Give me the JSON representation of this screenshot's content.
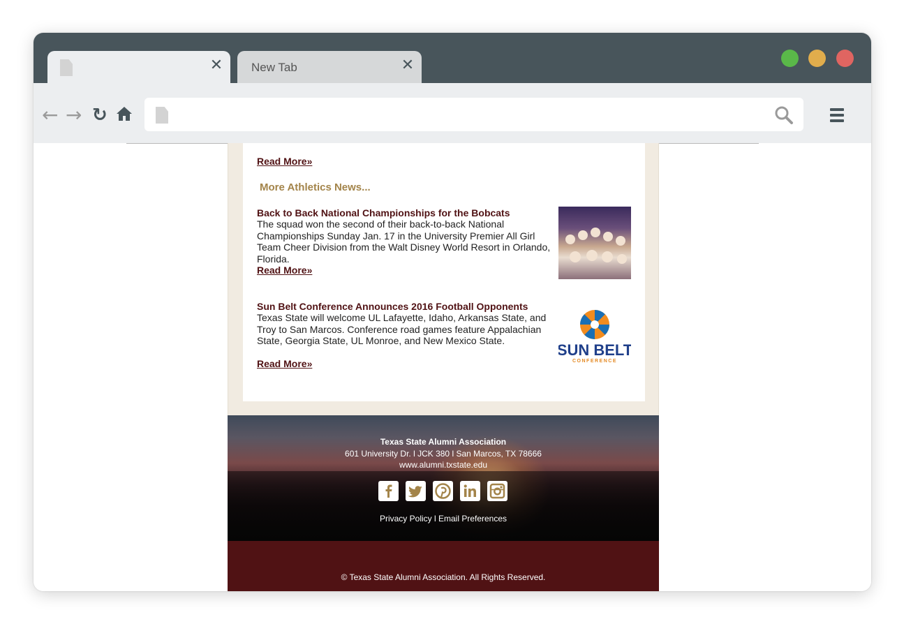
{
  "browser": {
    "tabs": [
      {
        "label": ""
      },
      {
        "label": "New Tab"
      }
    ],
    "address": ""
  },
  "email": {
    "read_more_label": "Read More»",
    "section_heading": "More Athletics News...",
    "articles": [
      {
        "title": "Back to Back National Championships for the Bobcats",
        "body": "The squad won the second of their back-to-back National Championships Sunday Jan. 17 in the University Premier All Girl Team Cheer Division from the Walt Disney World Resort in Orlando, Florida.",
        "read_more": "Read More»",
        "image": "cheer-team-photo"
      },
      {
        "title": "Sun Belt Conference Announces 2016 Football Opponents",
        "body": "Texas State will welcome UL Lafayette, Idaho, Arkansas State, and Troy to San Marcos.  Conference road games feature Appalachian State, Georgia State, UL Monroe, and New Mexico State.",
        "read_more": "Read More»",
        "image": "sun-belt-logo",
        "logo_text": "SUN BELT",
        "logo_subtext": "CONFERENCE"
      }
    ]
  },
  "footer": {
    "org": "Texas State Alumni Association",
    "address": "601 University Dr. l JCK 380 l San Marcos, TX 78666",
    "url": "www.alumni.txstate.edu",
    "social": [
      "facebook-icon",
      "twitter-icon",
      "pinterest-icon",
      "linkedin-icon",
      "instagram-icon"
    ],
    "links": "Privacy Policy l Email Preferences",
    "copyright": "© Texas State Alumni Association. All Rights Reserved."
  },
  "colors": {
    "maroon": "#501214",
    "gold": "#a3844a",
    "chrome": "#48555b"
  }
}
